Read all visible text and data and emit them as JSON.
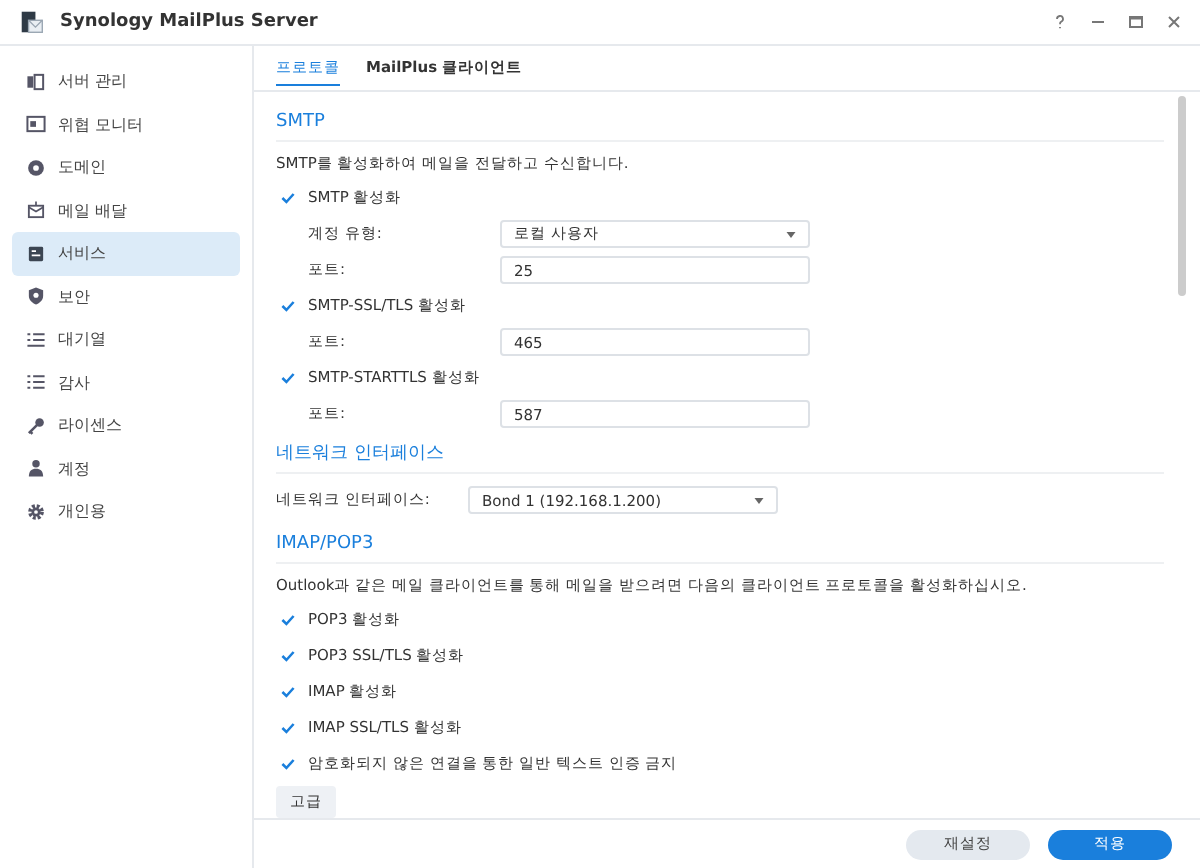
{
  "window": {
    "title": "Synology MailPlus Server"
  },
  "sidebar": {
    "items": [
      {
        "label": "서버 관리",
        "selected": false
      },
      {
        "label": "위협 모니터",
        "selected": false
      },
      {
        "label": "도메인",
        "selected": false
      },
      {
        "label": "메일 배달",
        "selected": false
      },
      {
        "label": "서비스",
        "selected": true
      },
      {
        "label": "보안",
        "selected": false
      },
      {
        "label": "대기열",
        "selected": false
      },
      {
        "label": "감사",
        "selected": false
      },
      {
        "label": "라이센스",
        "selected": false
      },
      {
        "label": "계정",
        "selected": false
      },
      {
        "label": "개인용",
        "selected": false
      }
    ]
  },
  "tabs": [
    {
      "label": "프로토콜",
      "selected": true
    },
    {
      "label": "MailPlus 클라이언트",
      "selected": false
    }
  ],
  "sections": [
    {
      "title": "SMTP",
      "description": "SMTP를 활성화하여 메일을 전달하고 수신합니다.",
      "rows": [
        {
          "kind": "checkbox",
          "label": "SMTP 활성화",
          "checked": true
        },
        {
          "kind": "select",
          "label": "계정 유형:",
          "value": "로컬 사용자"
        },
        {
          "kind": "input",
          "label": "포트:",
          "value": "25"
        },
        {
          "kind": "checkbox",
          "label": "SMTP-SSL/TLS 활성화",
          "checked": true
        },
        {
          "kind": "input",
          "label": "포트:",
          "value": "465"
        },
        {
          "kind": "checkbox",
          "label": "SMTP-STARTTLS 활성화",
          "checked": true
        },
        {
          "kind": "input",
          "label": "포트:",
          "value": "587"
        }
      ]
    },
    {
      "title": "네트워크 인터페이스",
      "rows": [
        {
          "kind": "select",
          "label": "네트워크 인터페이스:",
          "value": "Bond 1 (192.168.1.200)"
        }
      ]
    },
    {
      "title": "IMAP/POP3",
      "description": "Outlook과 같은 메일 클라이언트를 통해 메일을 받으려면 다음의 클라이언트 프로토콜을 활성화하십시오.",
      "rows": [
        {
          "kind": "checkbox",
          "label": "POP3 활성화",
          "checked": true
        },
        {
          "kind": "checkbox",
          "label": "POP3 SSL/TLS 활성화",
          "checked": true
        },
        {
          "kind": "checkbox",
          "label": "IMAP 활성화",
          "checked": true
        },
        {
          "kind": "checkbox",
          "label": "IMAP SSL/TLS 활성화",
          "checked": true
        },
        {
          "kind": "checkbox",
          "label": "암호화되지 않은 연결을 통한 일반 텍스트 인증 금지",
          "checked": true
        },
        {
          "kind": "button",
          "label": "고급"
        }
      ]
    }
  ],
  "footer": {
    "buttons": [
      {
        "label": "재설정",
        "kind": "secondary"
      },
      {
        "label": "적용",
        "kind": "primary"
      }
    ]
  }
}
